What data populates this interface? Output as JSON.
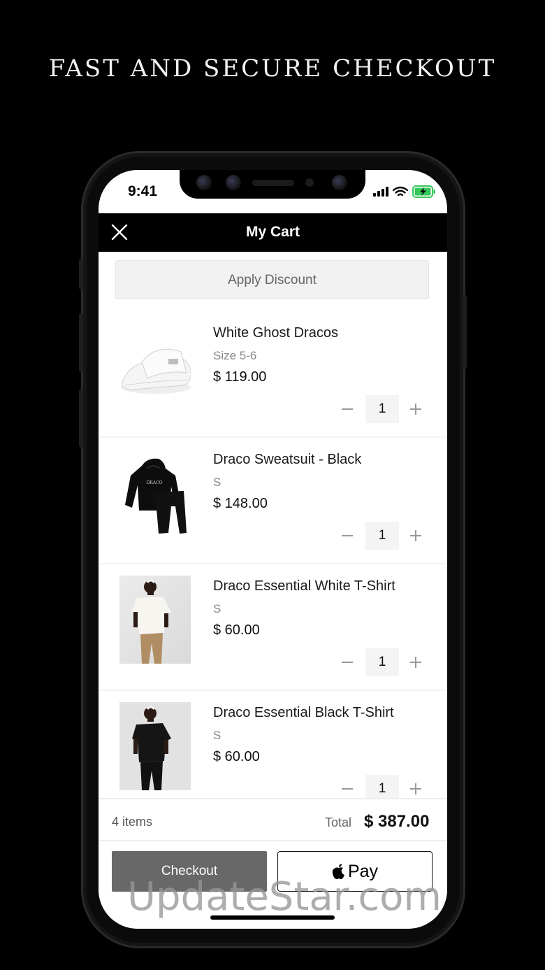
{
  "headline": "FAST AND SECURE CHECKOUT",
  "status_bar": {
    "time": "9:41",
    "icons": [
      "signal-icon",
      "wifi-icon",
      "battery-charging-icon"
    ]
  },
  "nav": {
    "title": "My Cart",
    "close_icon": "close-icon"
  },
  "discount": {
    "label": "Apply Discount"
  },
  "items": [
    {
      "name": "White Ghost Dracos",
      "size": "Size 5-6",
      "price": "$ 119.00",
      "qty": "1"
    },
    {
      "name": "Draco Sweatsuit - Black",
      "size": "S",
      "price": "$ 148.00",
      "qty": "1"
    },
    {
      "name": "Draco Essential White T-Shirt",
      "size": "S",
      "price": "$ 60.00",
      "qty": "1"
    },
    {
      "name": "Draco Essential Black T-Shirt",
      "size": "S",
      "price": "$ 60.00",
      "qty": "1"
    }
  ],
  "hoodie_print": "DRACO",
  "summary": {
    "count": "4 items",
    "total_label": "Total",
    "total_value": "$ 387.00"
  },
  "buttons": {
    "checkout": "Checkout",
    "applepay": "Pay"
  },
  "watermark": "UpdateStar.com",
  "colors": {
    "accent": "#000000",
    "checkout_bg": "#686868",
    "battery": "#34c759"
  }
}
